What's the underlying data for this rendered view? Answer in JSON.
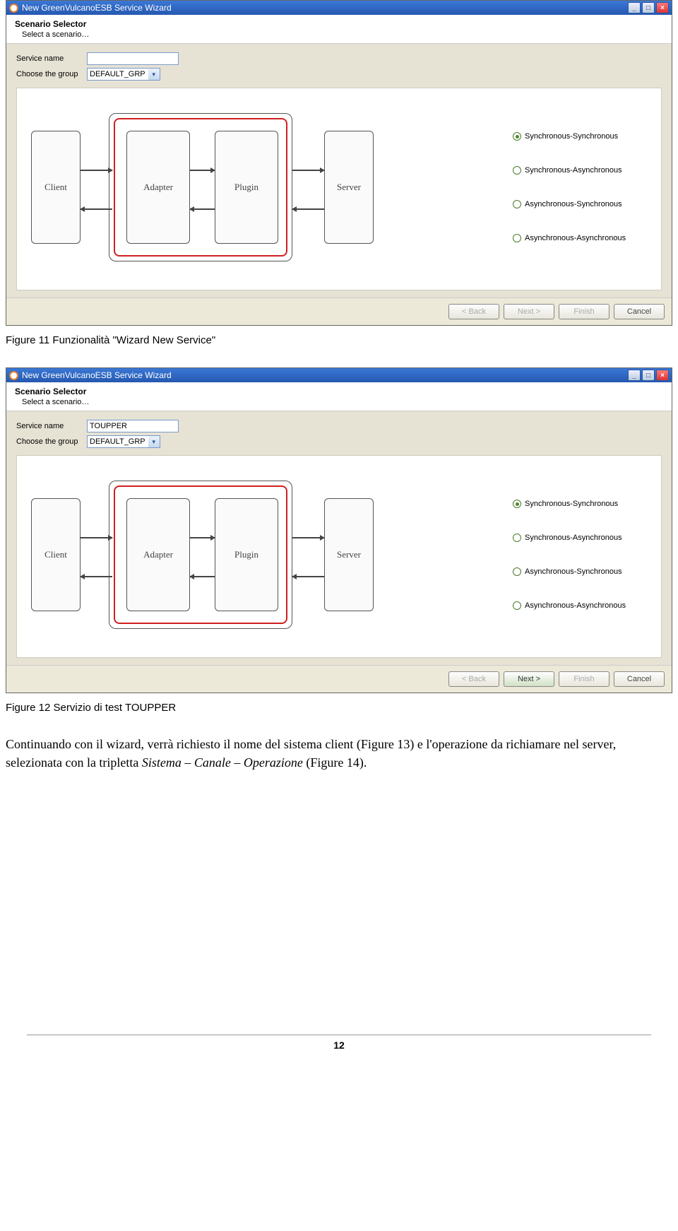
{
  "captions": {
    "fig11": "Figure 11 Funzionalità \"Wizard New Service\"",
    "fig12": "Figure 12 Servizio di test TOUPPER"
  },
  "body_text": {
    "p1a": "Continuando con il wizard, verrà richiesto il nome del sistema client (Figure 13) e l'operazione da richiamare nel server, selezionata con la tripletta ",
    "p1b": "Sistema – Canale – Operazione",
    "p1c": " (Figure 14)."
  },
  "page_number": "12",
  "win": {
    "title": "New GreenVulcanoESB Service Wizard",
    "head": "Scenario Selector",
    "head_sub": "Select a scenario…",
    "labels": {
      "service": "Service name",
      "group": "Choose the group"
    },
    "group_value": "DEFAULT_GRP",
    "boxes": {
      "client": "Client",
      "adapter": "Adapter",
      "plugin": "Plugin",
      "server": "Server"
    },
    "radios": [
      "Synchronous-Synchronous",
      "Synchronous-Asynchronous",
      "Asynchronous-Synchronous",
      "Asynchronous-Asynchronous"
    ],
    "buttons": {
      "back": "< Back",
      "next": "Next >",
      "finish": "Finish",
      "cancel": "Cancel"
    }
  },
  "win1": {
    "service_value": ""
  },
  "win2": {
    "service_value": "TOUPPER"
  }
}
